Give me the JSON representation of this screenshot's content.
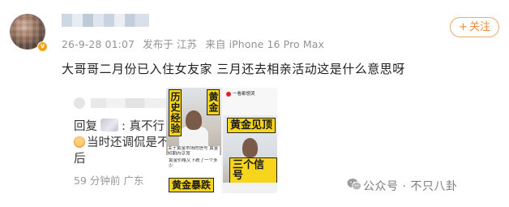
{
  "post": {
    "meta": {
      "date": "26-9-28 01:07",
      "location": "发布于 江苏",
      "device": "来自 iPhone 16 Pro Max"
    },
    "follow_label": "关注",
    "content": "大哥哥二月份已入住女友家 三月还去相亲活动这是什么意思呀"
  },
  "reply": {
    "prefix": "回复",
    "text_after": ": 真不行",
    "line2": "当时还调侃是不",
    "line3": "后",
    "time_location": "59 分钟前 广东"
  },
  "media": {
    "tags": {
      "p1_left": "历史经验",
      "p1_right": "黄金",
      "p3_top": "黄金见顶",
      "p3_bottom": "三个信号",
      "p4": "黄金暴跌"
    },
    "captions": {
      "p2": "一看都想哭",
      "p1_card": "关于黄金市场的信号 黄金短期内见顶",
      "p4_card": "黄金价格又下跌了一个多少"
    }
  },
  "watermark": "公众号 · 不只八卦",
  "colors": {
    "follow_border": "#f0a86c",
    "follow_text": "#ec8a3e",
    "meta_gray": "#939393",
    "tag_yellow": "#f7d51c"
  }
}
